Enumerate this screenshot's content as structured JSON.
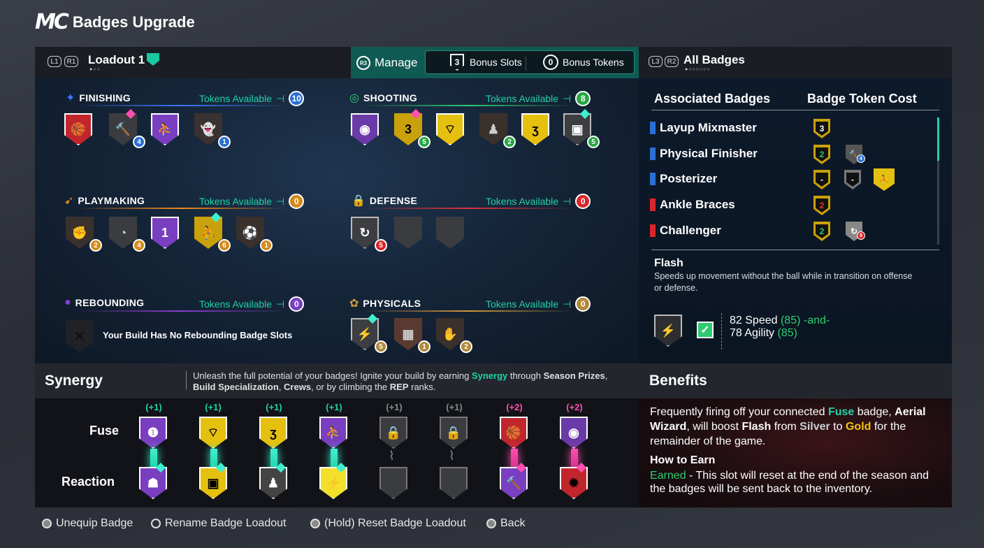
{
  "header": {
    "logo": "MC",
    "title": "Badges Upgrade"
  },
  "loadout": {
    "key1": "L1",
    "key2": "R1",
    "title": "Loadout 1"
  },
  "manage": {
    "key": "R3",
    "label": "Manage",
    "bonus_slots_count": "3",
    "bonus_slots_label": "Bonus Slots",
    "bonus_tokens_count": "0",
    "bonus_tokens_label": "Bonus Tokens"
  },
  "categories": {
    "finishing": {
      "name": "FINISHING",
      "tokens_label": "Tokens Available",
      "tokens": "10"
    },
    "shooting": {
      "name": "SHOOTING",
      "tokens_label": "Tokens Available",
      "tokens": "8"
    },
    "playmaking": {
      "name": "PLAYMAKING",
      "tokens_label": "Tokens Available",
      "tokens": "0"
    },
    "defense": {
      "name": "DEFENSE",
      "tokens_label": "Tokens Available",
      "tokens": "0"
    },
    "rebounding": {
      "name": "REBOUNDING",
      "tokens_label": "Tokens Available",
      "tokens": "0",
      "empty_text": "Your Build Has No Rebounding Badge Slots"
    },
    "physicals": {
      "name": "PHYSICALS",
      "tokens_label": "Tokens Available",
      "tokens": "0"
    }
  },
  "badge_nums": {
    "f1": "4",
    "f2": "1",
    "s1": "5",
    "s2": "2",
    "s3": "5",
    "p1": "2",
    "p2": "4",
    "p3": "6",
    "p4": "1",
    "p_inner": "1",
    "d1": "5",
    "ph1": "5",
    "ph2": "1",
    "ph3": "2"
  },
  "all_badges": {
    "key1": "L3",
    "key2": "R2",
    "title": "All Badges"
  },
  "associated": {
    "col1": "Associated Badges",
    "col2": "Badge Token Cost",
    "rows": [
      {
        "name": "Layup Mixmaster",
        "cost": "3"
      },
      {
        "name": "Physical Finisher",
        "cost": "2"
      },
      {
        "name": "Posterizer",
        "cost": "-"
      },
      {
        "name": "Ankle Braces",
        "cost": "2"
      },
      {
        "name": "Challenger",
        "cost": "2"
      }
    ],
    "extra": {
      "posterizer_2": "-",
      "pf_dot": "4",
      "ch_dot": "8"
    }
  },
  "flash": {
    "title": "Flash",
    "desc": "Speeds up movement without the ball while in transition on offense or defense.",
    "req1": "82 Speed",
    "req1_val": "(85)",
    "and": "-and-",
    "req2": "78 Agility",
    "req2_val": "(85)"
  },
  "synergy": {
    "title": "Synergy",
    "desc_pre": "Unleash the full potential of your badges! Ignite your build by earning ",
    "desc_syn": "Synergy",
    "desc_mid": " through ",
    "desc_b1": "Season Prizes",
    "desc_c1": ", ",
    "desc_b2": "Build Specialization",
    "desc_c2": ", ",
    "desc_b3": "Crews",
    "desc_c3": ", or by climbing the ",
    "desc_b4": "REP",
    "desc_end": " ranks.",
    "fuse_label": "Fuse",
    "reaction_label": "Reaction",
    "plus": [
      "(+1)",
      "(+1)",
      "(+1)",
      "(+1)",
      "(+1)",
      "(+1)",
      "(+2)",
      "(+2)"
    ]
  },
  "benefits": {
    "title": "Benefits",
    "t1": "Frequently firing off your connected ",
    "fuse": "Fuse",
    "t2": " badge, ",
    "aerial": "Aerial Wizard",
    "t3": ", will boost ",
    "flash": "Flash",
    "t4": " from ",
    "silver": "Silver",
    "t5": " to ",
    "gold": "Gold",
    "t6": " for the remainder of the game.",
    "how_title": "How to Earn",
    "earned": "Earned",
    "how_text": " - This slot will reset at the end of the season and the badges will be sent back to the inventory."
  },
  "footer": {
    "unequip": "Unequip Badge",
    "rename": "Rename Badge Loadout",
    "reset": "(Hold) Reset Badge Loadout",
    "back": "Back"
  },
  "colors": {
    "teal": "#22d2a8",
    "green": "#2ecc71",
    "gold": "#f2c40f",
    "purple": "#8a3fd1",
    "red": "#d9262a",
    "pink": "#ff4fb0"
  }
}
